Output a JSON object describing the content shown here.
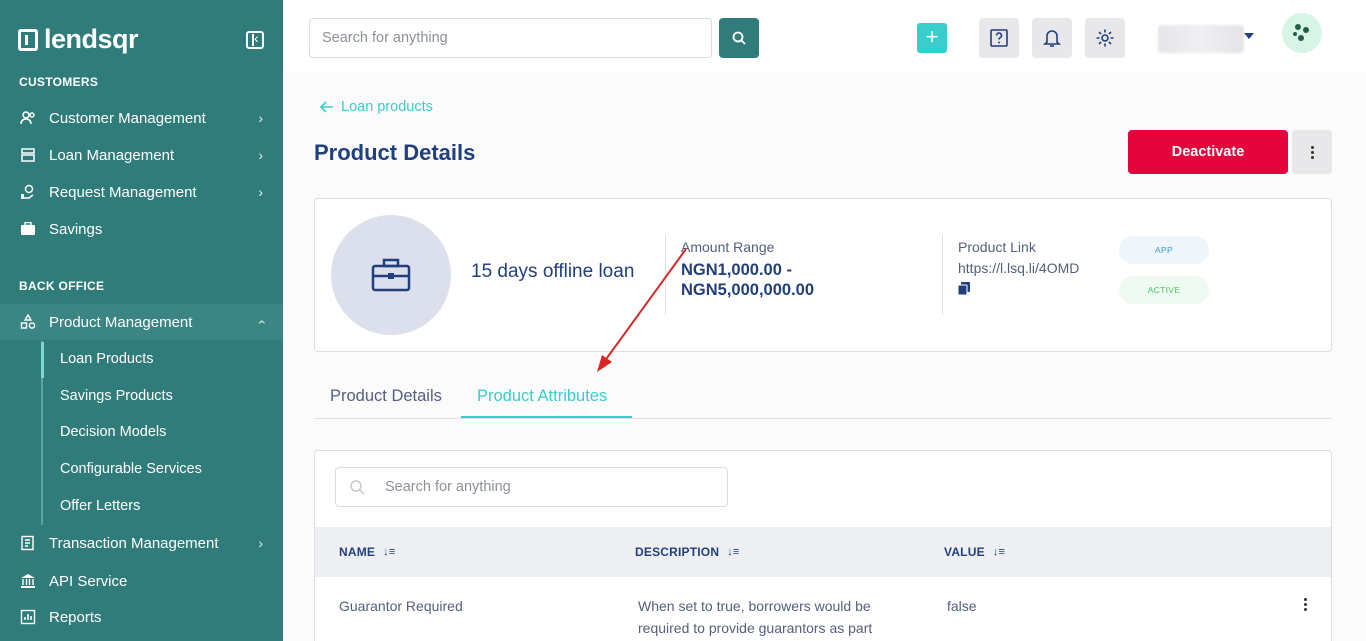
{
  "brand": {
    "name": "lendsqr"
  },
  "sidebar": {
    "customers_title": "CUSTOMERS",
    "customers": [
      {
        "label": "Customer Management"
      },
      {
        "label": "Loan Management"
      },
      {
        "label": "Request Management"
      },
      {
        "label": "Savings"
      }
    ],
    "back_office_title": "BACK OFFICE",
    "product_management": "Product Management",
    "sub_items": [
      {
        "label": "Loan Products"
      },
      {
        "label": "Savings Products"
      },
      {
        "label": "Decision Models"
      },
      {
        "label": "Configurable Services"
      },
      {
        "label": "Offer Letters"
      }
    ],
    "more": [
      {
        "label": "Transaction Management"
      },
      {
        "label": "API Service"
      },
      {
        "label": "Reports"
      }
    ]
  },
  "topbar": {
    "search_placeholder": "Search for anything"
  },
  "main": {
    "back_label": "Loan products",
    "title": "Product Details",
    "deactivate_label": "Deactivate",
    "product": {
      "name": "15 days offline loan",
      "amount_label": "Amount Range",
      "amount_line1": "NGN1,000.00 -",
      "amount_line2": "NGN5,000,000.00",
      "link_label": "Product Link",
      "link_value": "https://l.lsq.li/4OMD",
      "pill_app": "APP",
      "pill_active": "ACTIVE"
    },
    "tabs": [
      {
        "label": "Product Details"
      },
      {
        "label": "Product Attributes"
      }
    ],
    "table": {
      "search_placeholder": "Search for anything",
      "columns": [
        "NAME",
        "DESCRIPTION",
        "VALUE"
      ],
      "rows": [
        {
          "name": "Guarantor Required",
          "description_line1": "When set to true, borrowers would be",
          "description_line2": "required to provide guarantors as part",
          "value": "false"
        }
      ]
    }
  },
  "colors": {
    "sidebar": "#2f7c7a",
    "accent": "#39cdcc",
    "danger": "#e4033b",
    "text": "#213f7d"
  }
}
